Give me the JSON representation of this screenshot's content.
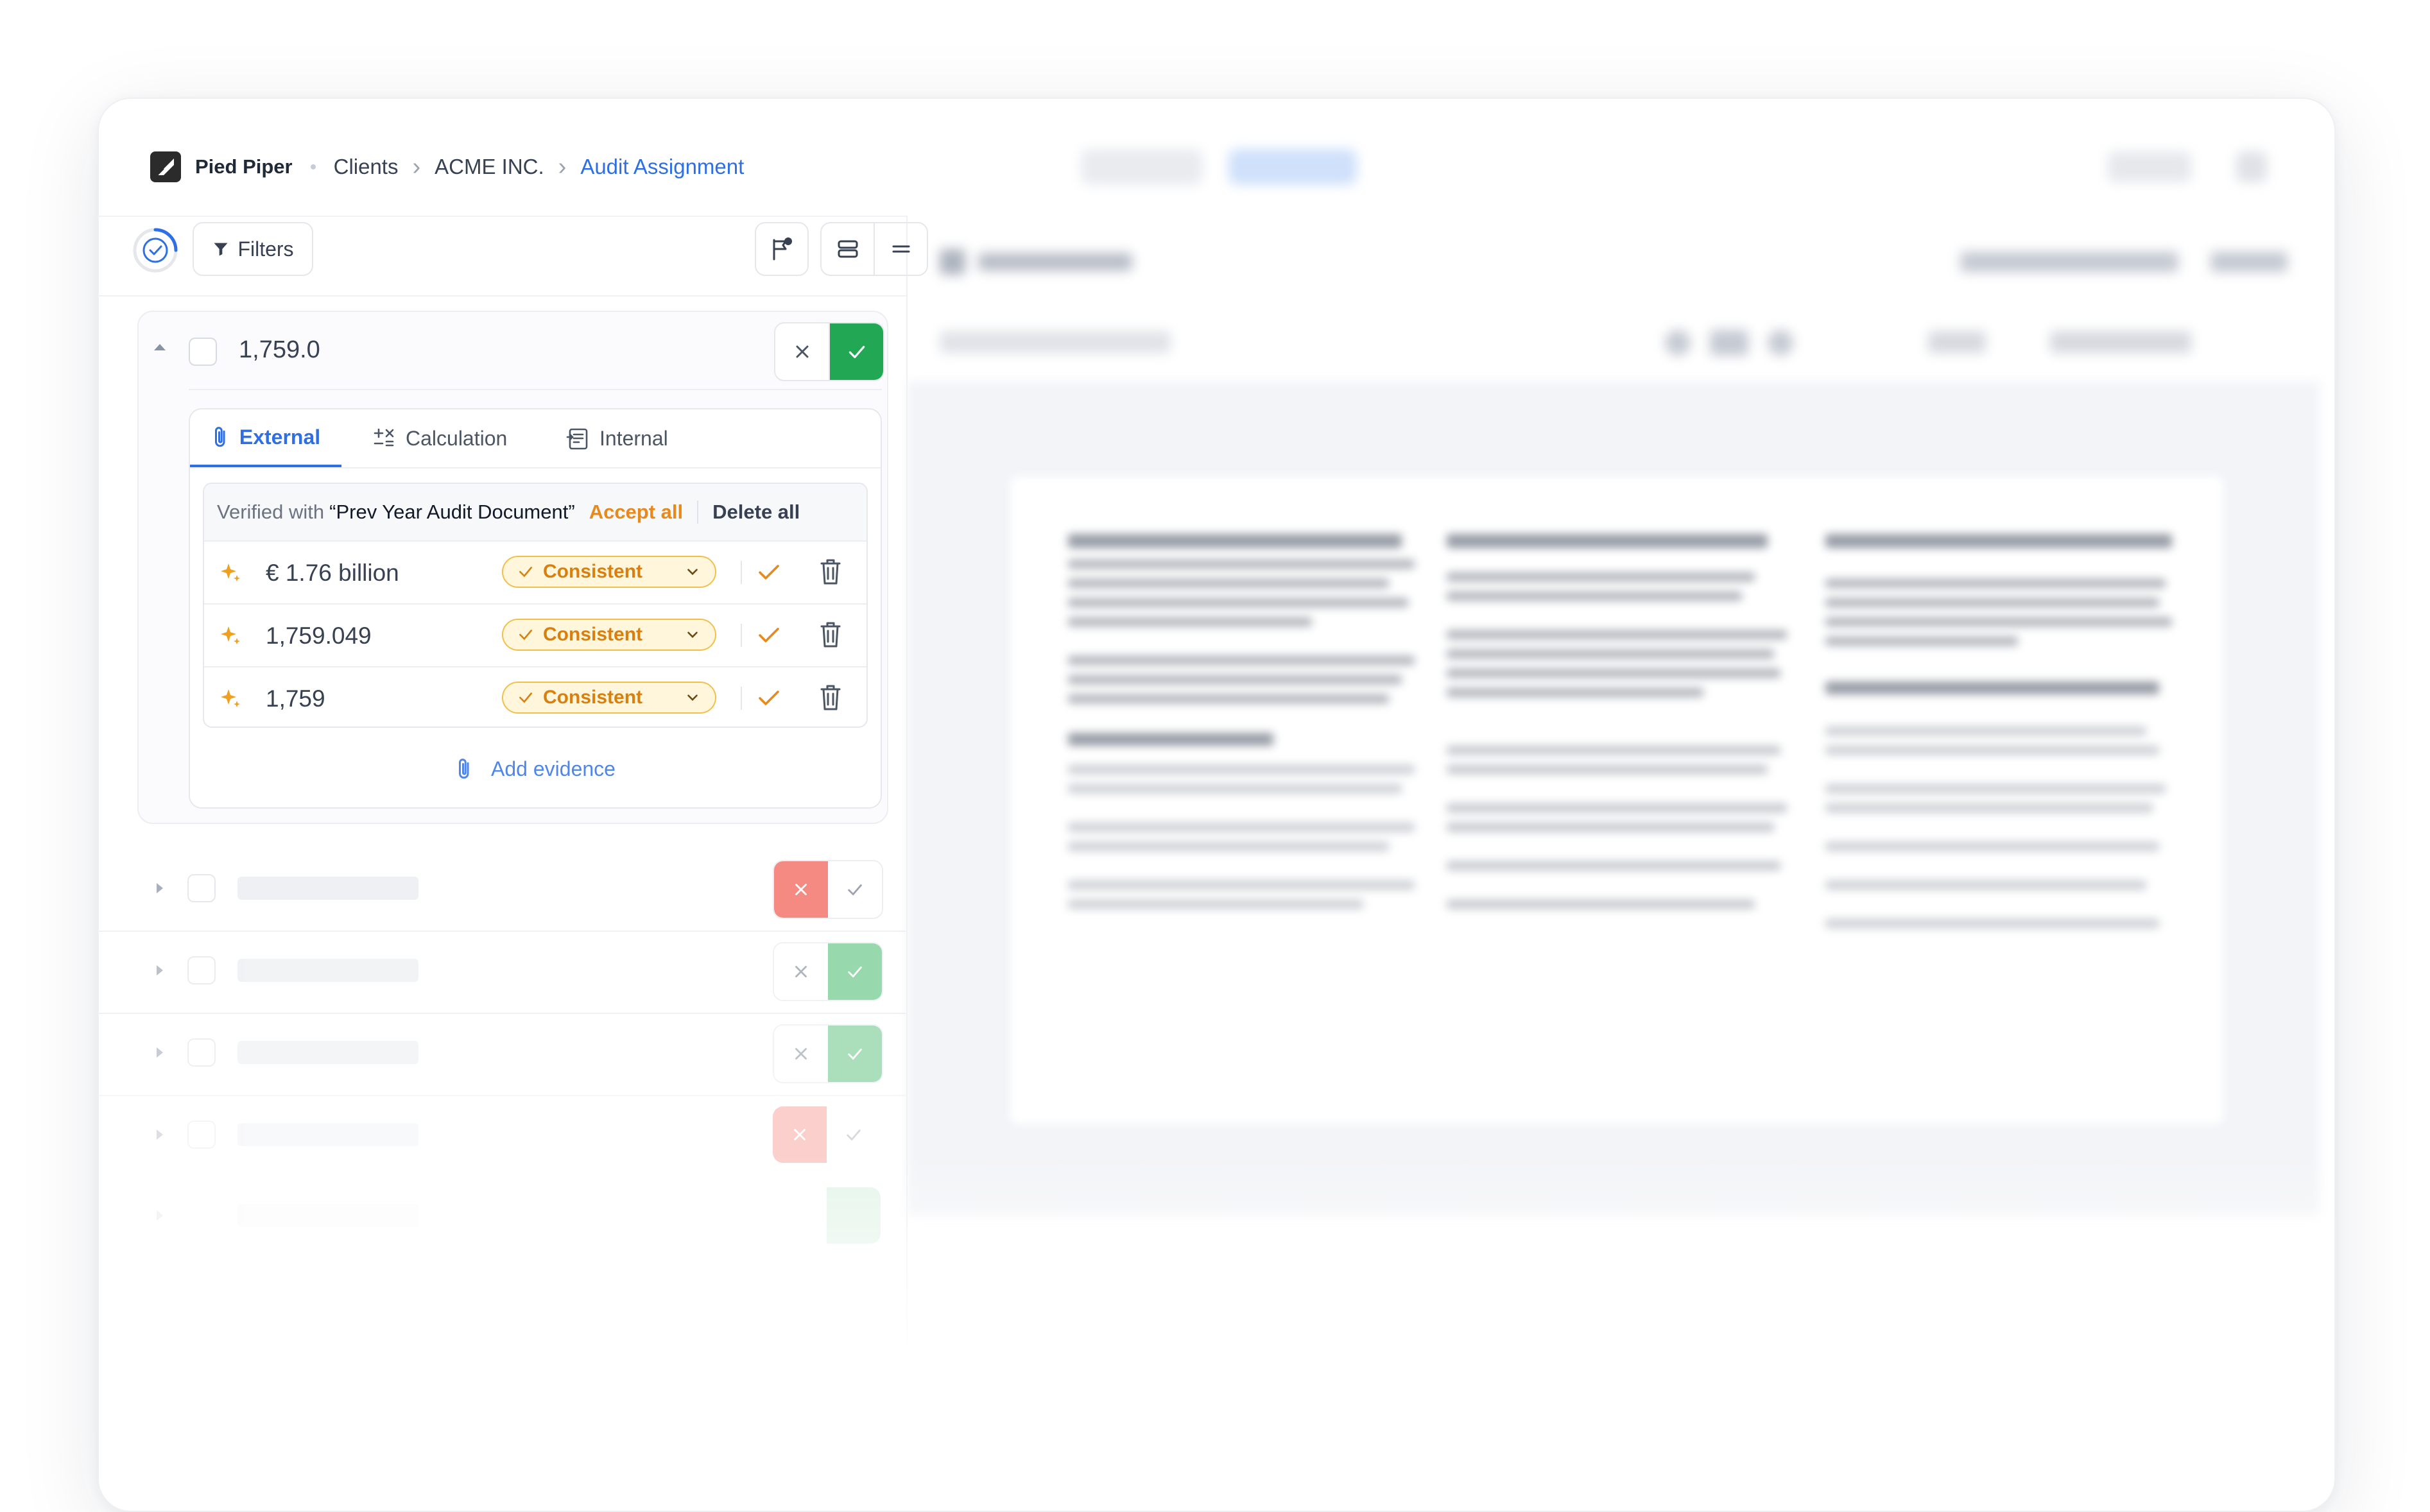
{
  "breadcrumb": {
    "brand": "Pied Piper",
    "items": [
      "Clients",
      "ACME INC."
    ],
    "current": "Audit Assignment"
  },
  "toolbar": {
    "filters_label": "Filters"
  },
  "item": {
    "value": "1,759.0",
    "tabs": [
      {
        "label": "External",
        "icon": "paperclip-icon",
        "active": true
      },
      {
        "label": "Calculation",
        "icon": "calculator-icon",
        "active": false
      },
      {
        "label": "Internal",
        "icon": "document-icon",
        "active": false
      }
    ],
    "verified": {
      "prefix": "Verified with",
      "document": "“Prev Year Audit Document”",
      "accept_all": "Accept all",
      "delete_all": "Delete all"
    },
    "evidence": [
      {
        "value": "€ 1.76 billion",
        "status": "Consistent"
      },
      {
        "value": "1,759.049",
        "status": "Consistent"
      },
      {
        "value": "1,759",
        "status": "Consistent"
      }
    ],
    "add_evidence": "Add evidence"
  },
  "colors": {
    "accent": "#2f6fe4",
    "accept": "#22a755",
    "reject": "#f0807a",
    "consistent": "#d97f0e"
  }
}
